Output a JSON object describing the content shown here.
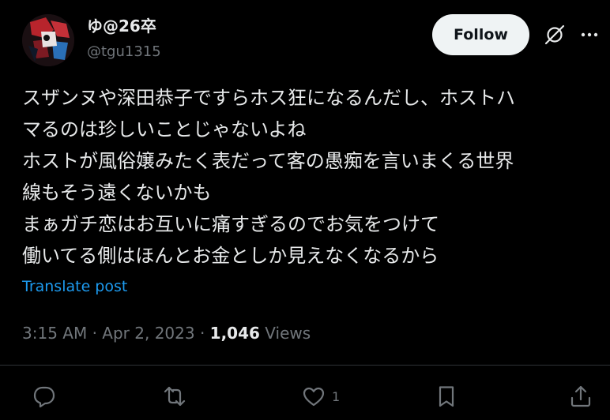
{
  "author": {
    "display_name": "ゆ@26卒",
    "handle": "@tgu1315"
  },
  "header": {
    "follow_label": "Follow"
  },
  "post": {
    "lines": [
      "スザンヌや深田恭子ですらホス狂になるんだし、ホストハ",
      "マるのは珍しいことじゃないよね",
      "ホストが風俗嬢みたく表だって客の愚痴を言いまくる世界",
      "線もそう遠くないかも",
      "まぁガチ恋はお互いに痛すぎるのでお気をつけて",
      "働いてる側はほんとお金としか見えなくなるから"
    ],
    "translate_label": "Translate post"
  },
  "meta": {
    "time": "3:15 AM",
    "sep": " · ",
    "date": "Apr 2, 2023",
    "views_count": "1,046",
    "views_label": " Views"
  },
  "actions": {
    "like_count": "1"
  },
  "colors": {
    "background": "#000000",
    "text": "#e7e9ea",
    "muted": "#71767b",
    "link": "#1d9bf0",
    "follow_bg": "#eff3f4"
  }
}
